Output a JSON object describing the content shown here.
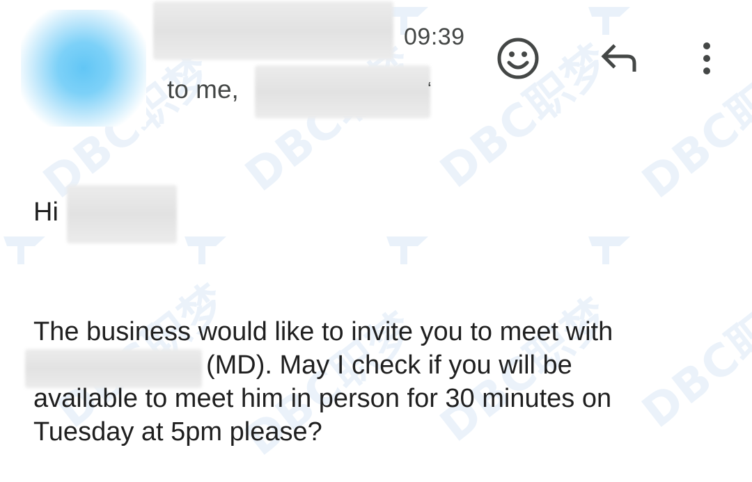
{
  "header": {
    "time": "09:39",
    "recipients_label": "to me,"
  },
  "actions": {
    "emoji_icon": "smile-face-icon",
    "reply_icon": "reply-arrow-icon",
    "more_icon": "vertical-dots-icon"
  },
  "message": {
    "greeting": "Hi",
    "lines": [
      "The business would like to invite you to meet with",
      "(MD). May I check if you will be",
      "available to meet him in person for 30 minutes on",
      "Tuesday at 5pm please?"
    ]
  },
  "watermark": {
    "text": "DBC职梦"
  },
  "colors": {
    "text": "#1f1f1f",
    "secondary_text": "#444746",
    "avatar": "#62c6f5",
    "watermark": "#dbe9f7"
  }
}
